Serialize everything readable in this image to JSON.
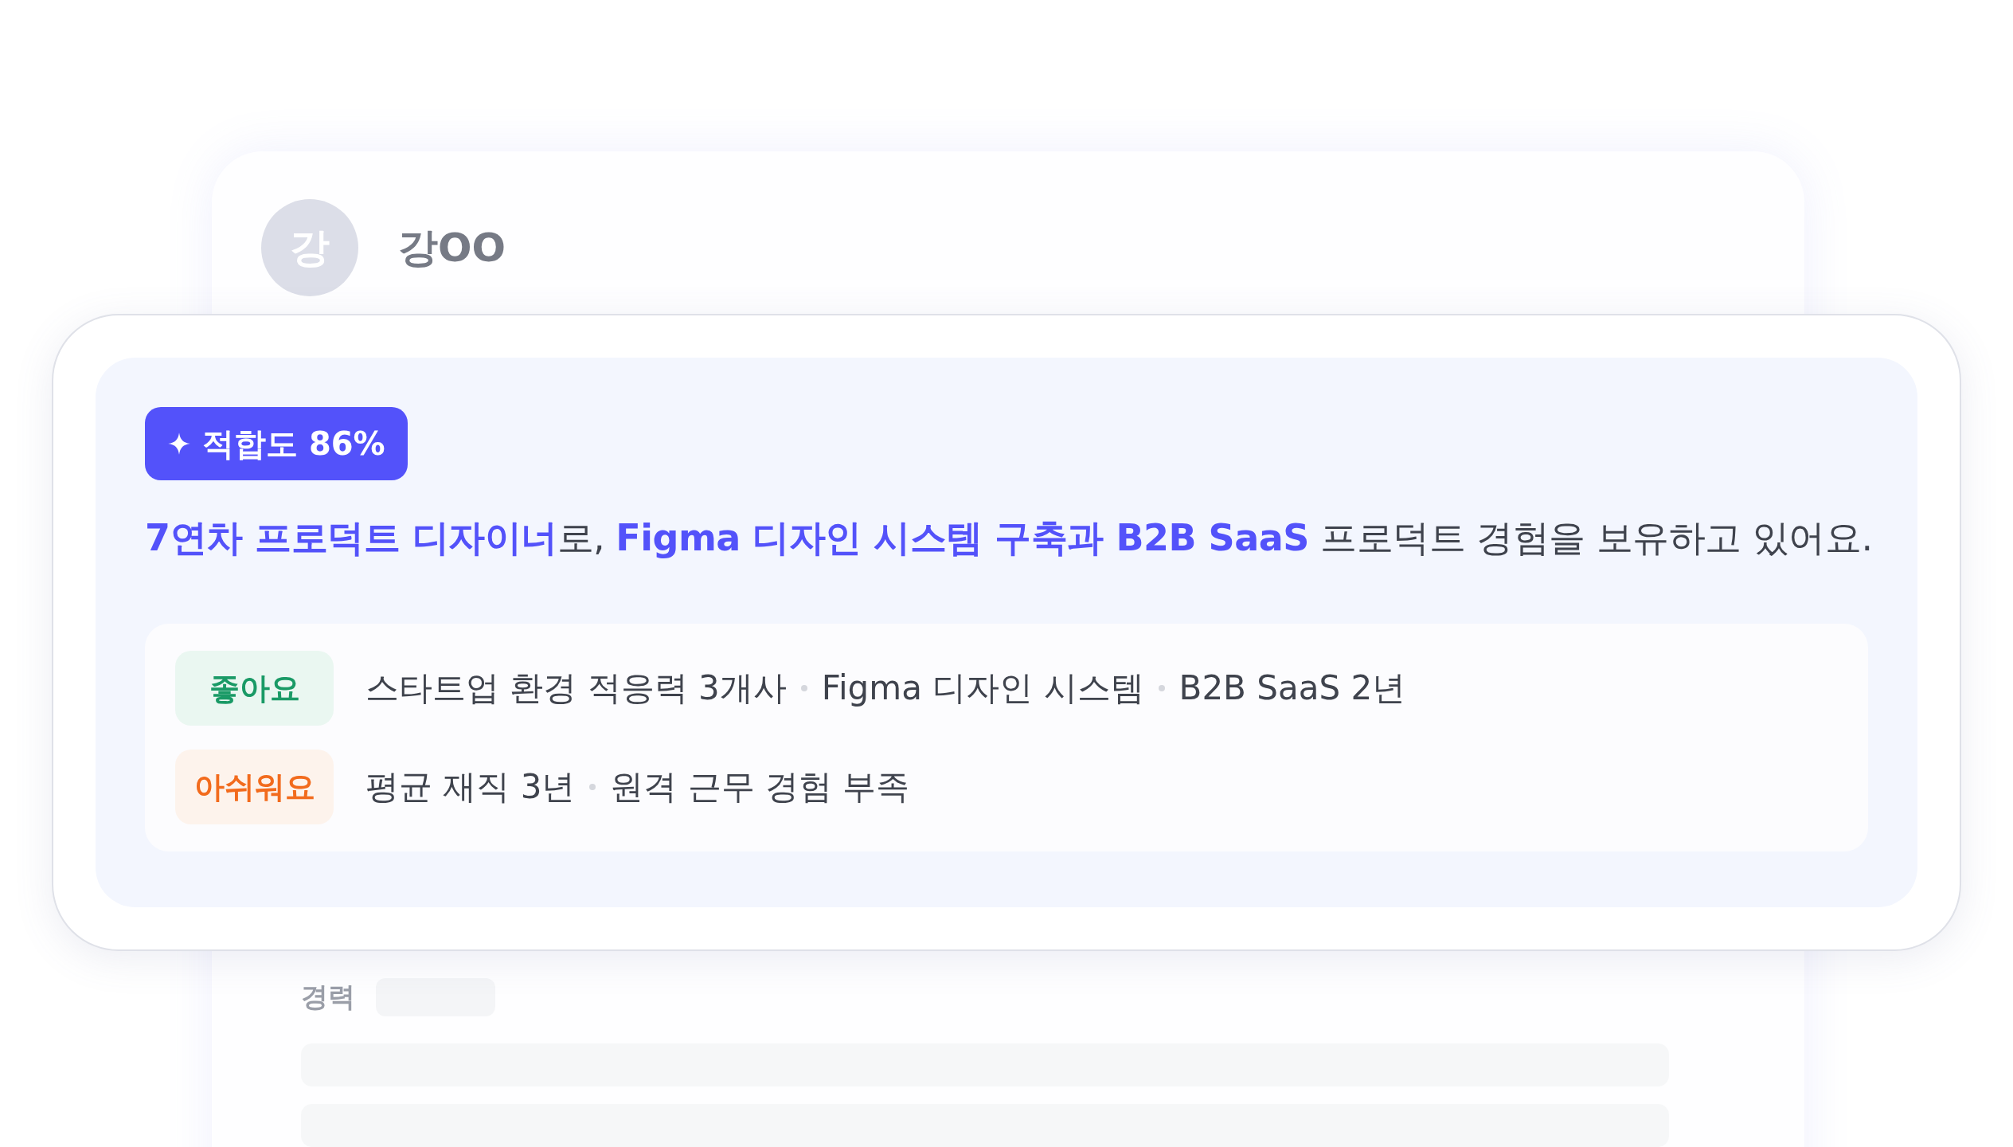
{
  "profile": {
    "avatar": "강",
    "name": "강OO"
  },
  "match": {
    "badge": "적합도 86%",
    "summary": [
      {
        "text": "7연차 프로덕트 디자이너",
        "highlight": true
      },
      {
        "text": "로, ",
        "highlight": false
      },
      {
        "text": "Figma 디자인 시스템 구축과 B2B SaaS",
        "highlight": true
      },
      {
        "text": " 프로덕트 경험을 보유하고 있어요.",
        "highlight": false
      }
    ],
    "rows": [
      {
        "kind": "pro",
        "label": "좋아요",
        "items": [
          "스타트업 환경 적응력 3개사",
          "Figma 디자인 시스템",
          "B2B SaaS 2년"
        ]
      },
      {
        "kind": "con",
        "label": "아쉬워요",
        "items": [
          "평균 재직 3년",
          "원격 근무 경험 부족"
        ]
      }
    ]
  },
  "career": {
    "label": "경력"
  }
}
